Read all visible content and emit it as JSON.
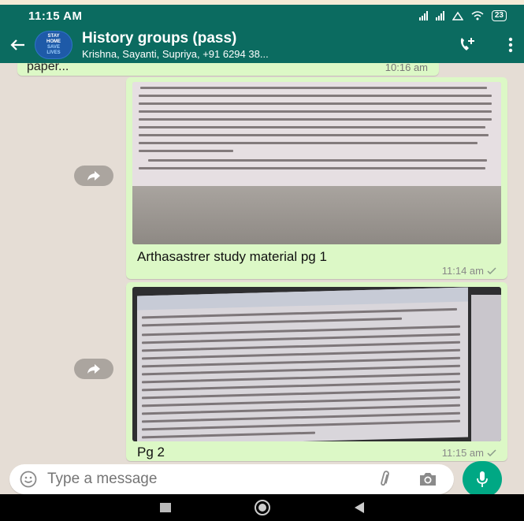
{
  "status_bar": {
    "time": "11:15 AM",
    "battery": "23"
  },
  "header": {
    "title": "History groups (pass)",
    "subtitle": "Krishna, Sayanti, Supriya, +91 6294 38...",
    "avatar_text": [
      "STAY",
      "HOME",
      "SAVE",
      "LIVES"
    ]
  },
  "messages": {
    "previous": {
      "text": "paper...",
      "time": "10:16 am"
    },
    "image1": {
      "caption": "Arthasastrer study material pg 1",
      "time": "11:14 am"
    },
    "image2": {
      "caption": "Pg 2",
      "time": "11:15 am"
    }
  },
  "composer": {
    "placeholder": "Type a message"
  },
  "colors": {
    "header": "#0b6b60",
    "bubble": "#dcf8c6",
    "background": "#e5ddd5",
    "mic": "#00a884"
  }
}
